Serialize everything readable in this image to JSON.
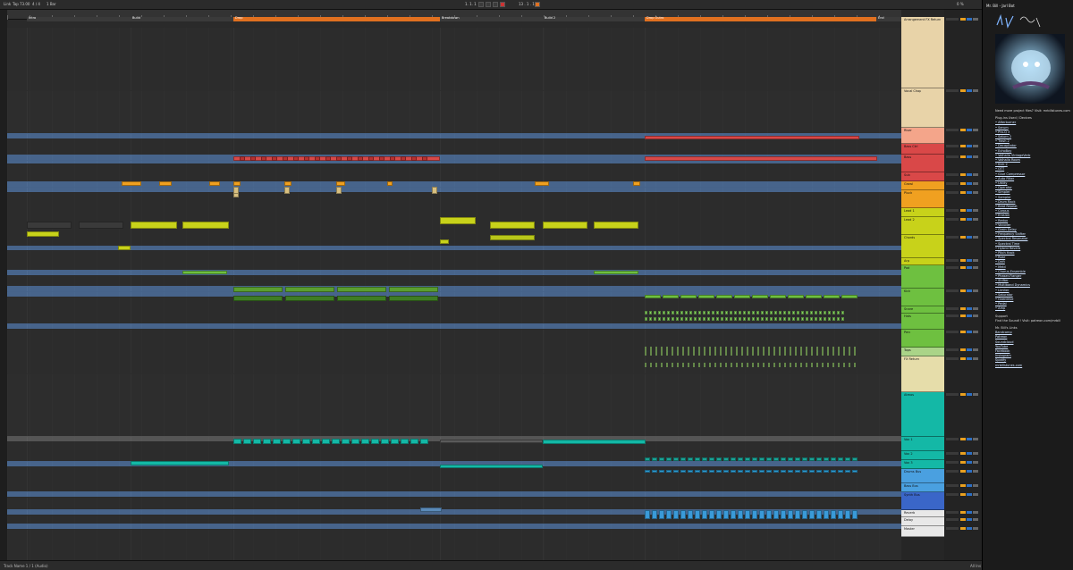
{
  "topbar": {
    "menu": [
      "Link",
      "Tap",
      "73.00",
      "4 / 4",
      "1 Bar"
    ],
    "position": "1. 1. 1",
    "right_time": "13 . 1 . 1",
    "cpu": "0 %"
  },
  "locators": [
    {
      "label": "Intro",
      "color": "#3a3a3a"
    },
    {
      "label": "Build",
      "color": "#3a3a3a"
    },
    {
      "label": "Drop",
      "color": "#e07020"
    },
    {
      "label": "Breakdown",
      "color": "#3a3a3a"
    },
    {
      "label": "Build 2",
      "color": "#3a3a3a"
    },
    {
      "label": "Drop Outro",
      "color": "#e07020"
    },
    {
      "label": "End",
      "color": "#3a3a3a"
    }
  ],
  "tracks": [
    {
      "name": "Arrangement FX Return",
      "color": "#e8d3a8"
    },
    {
      "name": "Vocal Chop",
      "color": "#e8d3a8"
    },
    {
      "name": "Riser",
      "color": "#f4a58a"
    },
    {
      "name": "Bass Ctrl",
      "color": "#d94848"
    },
    {
      "name": "Bass",
      "color": "#d94848"
    },
    {
      "name": "Sub",
      "color": "#d94848"
    },
    {
      "name": "Growl",
      "color": "#f0a020"
    },
    {
      "name": "Pluck",
      "color": "#f0a020"
    },
    {
      "name": "Lead 1",
      "color": "#c8d21a"
    },
    {
      "name": "Lead 2",
      "color": "#c8d21a"
    },
    {
      "name": "Chords",
      "color": "#c8d21a"
    },
    {
      "name": "Arp",
      "color": "#c8d21a"
    },
    {
      "name": "Pad",
      "color": "#6ec040"
    },
    {
      "name": "Kick",
      "color": "#6ec040"
    },
    {
      "name": "Snare",
      "color": "#6ec040"
    },
    {
      "name": "Hats",
      "color": "#6ec040"
    },
    {
      "name": "Perc",
      "color": "#6ec040"
    },
    {
      "name": "Tops",
      "color": "#aad488"
    },
    {
      "name": "FX Return",
      "color": "#e6ddaa"
    },
    {
      "name": "Atmos",
      "color": "#14b8a6"
    },
    {
      "name": "Vox 1",
      "color": "#14b8a6"
    },
    {
      "name": "Vox 2",
      "color": "#14b8a6"
    },
    {
      "name": "Vox 3",
      "color": "#14b8a6"
    },
    {
      "name": "Drums Bus",
      "color": "#4aa0e0"
    },
    {
      "name": "Bass Bus",
      "color": "#4aa0e0"
    },
    {
      "name": "Synth Bus",
      "color": "#3a66c8"
    },
    {
      "name": "Reverb",
      "color": "#e8e8e8"
    },
    {
      "name": "Delay",
      "color": "#e8e8e8"
    },
    {
      "name": "Master",
      "color": "#e8e8e8"
    }
  ],
  "sidebar": {
    "title": "Mr. Bill - Jarl Bot",
    "intro": "Need more project files? Visit: mrbillstunes.com",
    "plugins_header": "Plug-ins Used / Devices",
    "plugins": [
      "Afterburner",
      "Serum",
      "Pro-Q 3",
      "Saturn 2",
      "Trash 2",
      "Decapitator",
      "EchoBoy",
      "Valhalla VintageVerb",
      "Valhalla Room",
      "Kick 2",
      "OTT",
      "Glue Compressor",
      "Auto Filter",
      "Utility",
      "Operator",
      "Simpler",
      "Sampler",
      "Drum Rack",
      "Beat Repeat",
      "Corpus",
      "Erosion",
      "Redux",
      "Vocoder",
      "Grain Delay",
      "Frequency Shifter",
      "Spectral Resonator",
      "Spectral Time",
      "Hybrid Reverb",
      "Pitch Hack",
      "Roar",
      "Drift",
      "Meld",
      "Chorus-Ensemble",
      "Phaser-Flanger",
      "Shifter",
      "Multiband Dynamics",
      "Limiter",
      "Saturator",
      "Overdrive",
      "Pedal",
      "Amp"
    ],
    "support_header": "Support",
    "support_text": "Find the Sound!! Visit: patreon.com/mrbill",
    "links_header": "Mr. Bill's Links",
    "links": [
      "Bandcamp",
      "Patreon",
      "Soundcloud",
      "YouTube",
      "Facebook",
      "Instagram",
      "Spotify",
      "mrbillstunes.com"
    ]
  },
  "statusbar": {
    "left": "Track Name 1 / 1 (Audio)",
    "right": "All Ins"
  },
  "colors": {
    "orange": "#e07020",
    "red": "#d94848",
    "yellow": "#f0a020",
    "lime": "#c8d21a",
    "green": "#6ec040",
    "teal": "#14b8a6",
    "blue": "#4aa0e0"
  }
}
